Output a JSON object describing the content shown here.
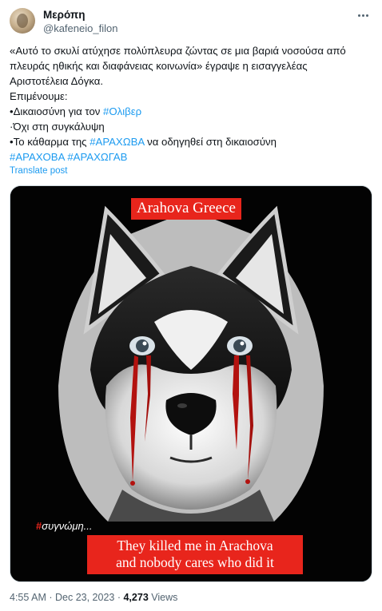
{
  "user": {
    "display_name": "Μερόπη",
    "handle": "@kafeneio_filon"
  },
  "tweet": {
    "lines": [
      [
        {
          "text": "«Αυτό το σκυλί ατύχησε πολύπλευρα ζώντας σε μια βαριά νοσούσα από"
        }
      ],
      [
        {
          "text": "πλευράς ηθικής και διαφάνειας κοινωνία» έγραψε η εισαγγελέας"
        }
      ],
      [
        {
          "text": "Αριστοτέλεια Δόγκα."
        }
      ],
      [
        {
          "text": "Επιμένουμε:"
        }
      ],
      [
        {
          "text": "•Δικαιοσύνη για τον "
        },
        {
          "text": "#Ολιβερ",
          "link": true
        }
      ],
      [
        {
          "text": "·Όχι στη συγκάλυψη"
        }
      ],
      [
        {
          "text": "•Το κάθαρμα της "
        },
        {
          "text": "#ΑΡΑΧΩΒΑ",
          "link": true
        },
        {
          "text": " να οδηγηθεί στη δικαιοσύνη"
        }
      ],
      [
        {
          "text": "#ΑΡΑΧΟΒΑ",
          "link": true
        },
        {
          "text": " "
        },
        {
          "text": "#ΑΡΑΧΩΓΑΒ",
          "link": true
        }
      ]
    ],
    "translate_label": "Translate post"
  },
  "image": {
    "caption_top": "Arahova Greece",
    "hashtag_symbol": "#",
    "hashtag_word": "συγνώμη...",
    "caption_bottom_line1": "They killed me in Arachova",
    "caption_bottom_line2": "and nobody cares who did it"
  },
  "meta": {
    "time": "4:55 AM",
    "date": "Dec 23, 2023",
    "views_count": "4,273",
    "views_label": "Views"
  },
  "colors": {
    "link": "#1d9bf0",
    "caption_red": "#e8251c",
    "secondary_text": "#536471"
  }
}
